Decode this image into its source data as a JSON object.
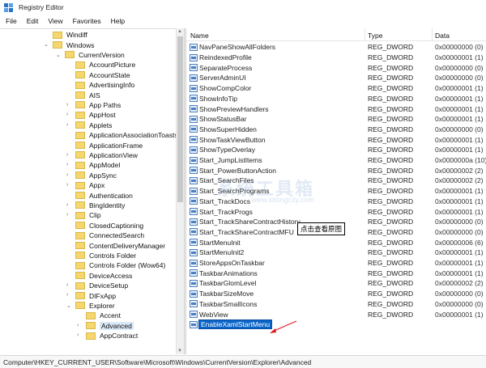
{
  "window": {
    "title": "Registry Editor"
  },
  "menu": [
    "File",
    "Edit",
    "View",
    "Favorites",
    "Help"
  ],
  "tree": {
    "items": [
      {
        "label": "Windiff"
      },
      {
        "label": "Windows"
      },
      {
        "label": "CurrentVersion"
      },
      {
        "label": "AccountPicture"
      },
      {
        "label": "AccountState"
      },
      {
        "label": "AdvertisingInfo"
      },
      {
        "label": "AIS"
      },
      {
        "label": "App Paths"
      },
      {
        "label": "AppHost"
      },
      {
        "label": "Applets"
      },
      {
        "label": "ApplicationAssociationToasts"
      },
      {
        "label": "ApplicationFrame"
      },
      {
        "label": "ApplicationView"
      },
      {
        "label": "AppModel"
      },
      {
        "label": "AppSync"
      },
      {
        "label": "Appx"
      },
      {
        "label": "Authentication"
      },
      {
        "label": "BingIdentity"
      },
      {
        "label": "Clip"
      },
      {
        "label": "ClosedCaptioning"
      },
      {
        "label": "ConnectedSearch"
      },
      {
        "label": "ContentDeliveryManager"
      },
      {
        "label": "Controls Folder"
      },
      {
        "label": "Controls Folder (Wow64)"
      },
      {
        "label": "DeviceAccess"
      },
      {
        "label": "DeviceSetup"
      },
      {
        "label": "DIFxApp"
      },
      {
        "label": "Explorer"
      },
      {
        "label": "Accent"
      },
      {
        "label": "Advanced"
      },
      {
        "label": "AppContract"
      }
    ]
  },
  "list": {
    "columns": {
      "name": "Name",
      "type": "Type",
      "data": "Data"
    },
    "rows": [
      {
        "name": "NavPaneShowAllFolders",
        "type": "REG_DWORD",
        "data": "0x00000000 (0)"
      },
      {
        "name": "ReindexedProfile",
        "type": "REG_DWORD",
        "data": "0x00000001 (1)"
      },
      {
        "name": "SeparateProcess",
        "type": "REG_DWORD",
        "data": "0x00000000 (0)"
      },
      {
        "name": "ServerAdminUI",
        "type": "REG_DWORD",
        "data": "0x00000000 (0)"
      },
      {
        "name": "ShowCompColor",
        "type": "REG_DWORD",
        "data": "0x00000001 (1)"
      },
      {
        "name": "ShowInfoTip",
        "type": "REG_DWORD",
        "data": "0x00000001 (1)"
      },
      {
        "name": "ShowPreviewHandlers",
        "type": "REG_DWORD",
        "data": "0x00000001 (1)"
      },
      {
        "name": "ShowStatusBar",
        "type": "REG_DWORD",
        "data": "0x00000001 (1)"
      },
      {
        "name": "ShowSuperHidden",
        "type": "REG_DWORD",
        "data": "0x00000000 (0)"
      },
      {
        "name": "ShowTaskViewButton",
        "type": "REG_DWORD",
        "data": "0x00000001 (1)"
      },
      {
        "name": "ShowTypeOverlay",
        "type": "REG_DWORD",
        "data": "0x00000001 (1)"
      },
      {
        "name": "Start_JumpListItems",
        "type": "REG_DWORD",
        "data": "0x0000000a (10)"
      },
      {
        "name": "Start_PowerButtonAction",
        "type": "REG_DWORD",
        "data": "0x00000002 (2)"
      },
      {
        "name": "Start_SearchFiles",
        "type": "REG_DWORD",
        "data": "0x00000002 (2)"
      },
      {
        "name": "Start_SearchPrograms",
        "type": "REG_DWORD",
        "data": "0x00000001 (1)"
      },
      {
        "name": "Start_TrackDocs",
        "type": "REG_DWORD",
        "data": "0x00000001 (1)"
      },
      {
        "name": "Start_TrackProgs",
        "type": "REG_DWORD",
        "data": "0x00000001 (1)"
      },
      {
        "name": "Start_TrackShareContractHistory",
        "type": "REG_DWORD",
        "data": "0x00000000 (0)"
      },
      {
        "name": "Start_TrackShareContractMFU",
        "type": "REG_DWORD",
        "data": "0x00000000 (0)"
      },
      {
        "name": "StartMenuInit",
        "type": "REG_DWORD",
        "data": "0x00000006 (6)"
      },
      {
        "name": "StartMenuInit2",
        "type": "REG_DWORD",
        "data": "0x00000001 (1)"
      },
      {
        "name": "StoreAppsOnTaskbar",
        "type": "REG_DWORD",
        "data": "0x00000001 (1)"
      },
      {
        "name": "TaskbarAnimations",
        "type": "REG_DWORD",
        "data": "0x00000001 (1)"
      },
      {
        "name": "TaskbarGlomLevel",
        "type": "REG_DWORD",
        "data": "0x00000002 (2)"
      },
      {
        "name": "TaskbarSizeMove",
        "type": "REG_DWORD",
        "data": "0x00000000 (0)"
      },
      {
        "name": "TaskbarSmallIcons",
        "type": "REG_DWORD",
        "data": "0x00000000 (0)"
      },
      {
        "name": "WebView",
        "type": "REG_DWORD",
        "data": "0x00000001 (1)"
      },
      {
        "name": "EnableXamlStartMenu",
        "type": "",
        "data": ""
      }
    ]
  },
  "tooltip": "点击查看原图",
  "watermark": {
    "main": "系统工具箱",
    "sub": "www.xitongcity.com"
  },
  "status": "Computer\\HKEY_CURRENT_USER\\Software\\Microsoft\\Windows\\CurrentVersion\\Explorer\\Advanced",
  "colors": {
    "accent": "#0a64c8",
    "folder": "#f5d76e",
    "arrow": "#e01818"
  }
}
